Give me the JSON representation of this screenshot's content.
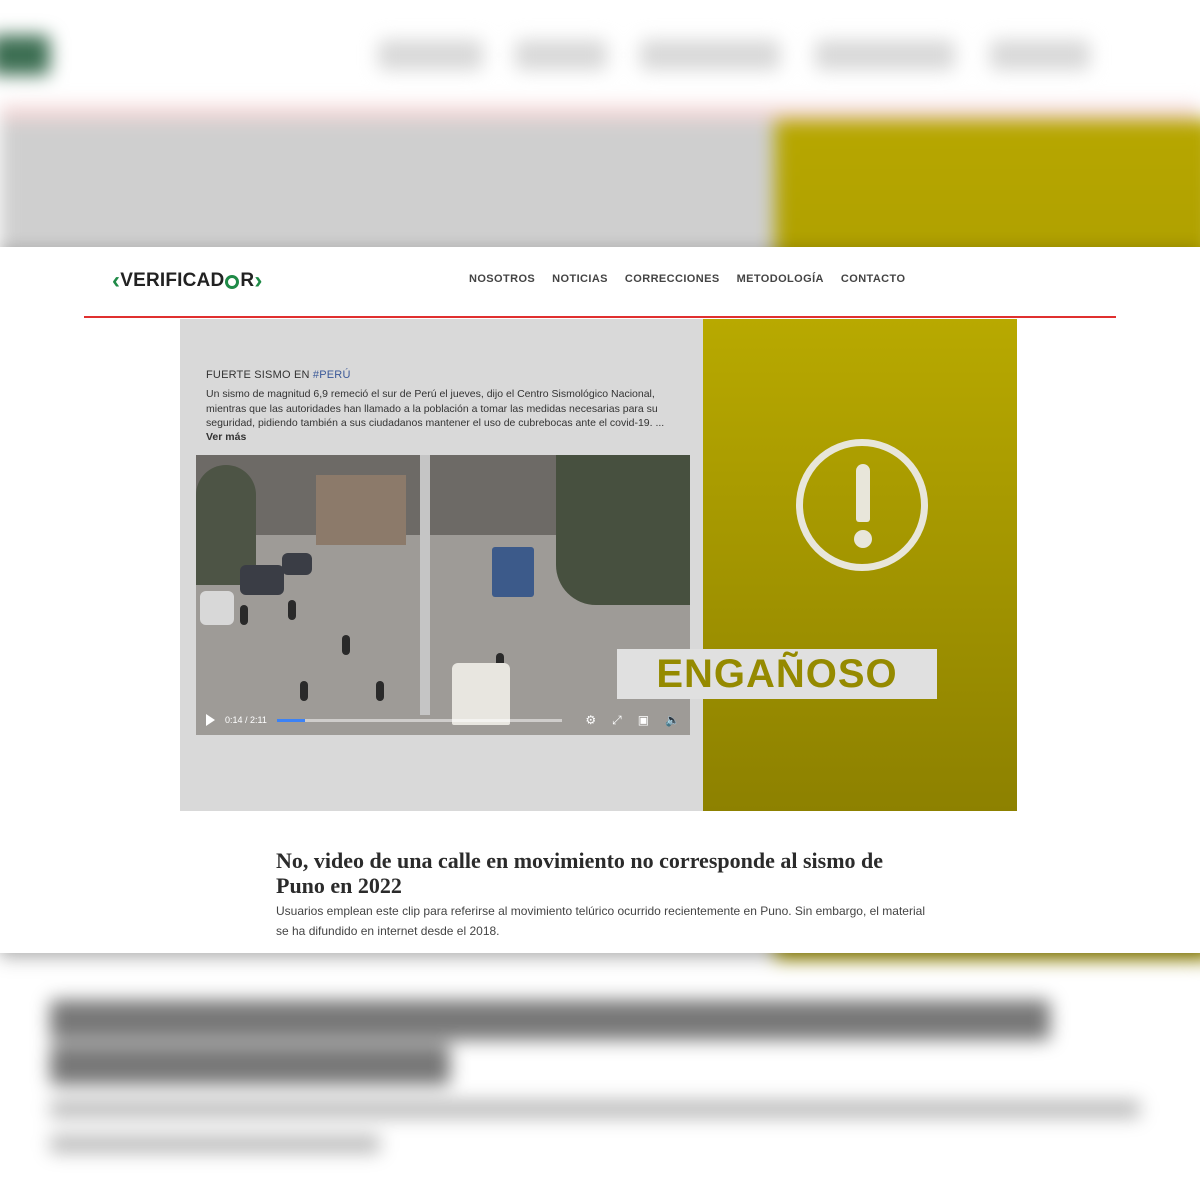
{
  "site": {
    "logo_text": "VERIFICADQR",
    "logo_left": "VERIFICAD",
    "logo_right": "R",
    "brand_green": "#1f8a47",
    "accent_red": "#e0302f"
  },
  "nav": {
    "items": [
      {
        "label": "NOSOTROS"
      },
      {
        "label": "NOTICIAS"
      },
      {
        "label": "CORRECCIONES"
      },
      {
        "label": "METODOLOGÍA"
      },
      {
        "label": "CONTACTO"
      }
    ]
  },
  "post": {
    "title_prefix": "FUERTE SISMO EN ",
    "hashtag": "#PERÚ",
    "body": "Un sismo de magnitud 6,9 remeció el sur de Perú el jueves, dijo el Centro Sismológico Nacional, mientras que las autoridades han llamado a la población a tomar las medidas necesarias para su seguridad, pidiendo también a sus ciudadanos mantener el uso de cubrebocas ante el covid-19. ...",
    "more_label": "Ver más"
  },
  "video": {
    "time": "0:14 / 2:11",
    "progress": 0.1
  },
  "verdict": {
    "label": "ENGAÑOSO",
    "icon": "exclamation-circle-icon",
    "panel_color": "#b8a900"
  },
  "article": {
    "headline": "No, video de una calle en movimiento no corresponde al sismo de Puno en 2022",
    "summary": "Usuarios emplean este clip para referirse al movimiento telúrico ocurrido recientemente en Puno. Sin embargo, el material se ha difundido en internet desde el 2018."
  }
}
